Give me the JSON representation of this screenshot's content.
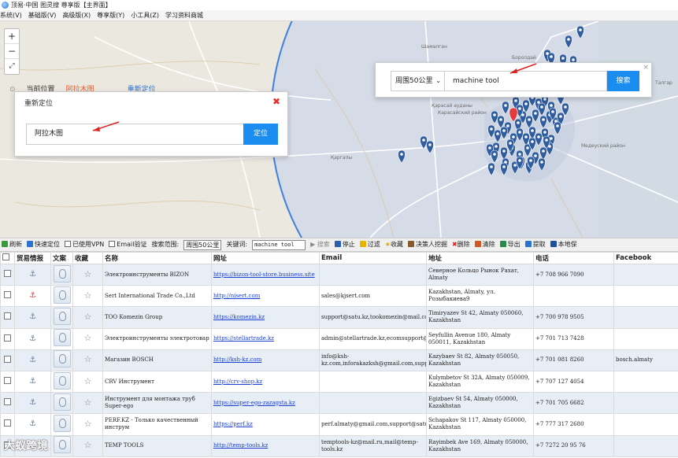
{
  "titlebar": {
    "title": "顶易·中国 图灵搜 尊享版【主界面】"
  },
  "menu": [
    "系统(V)",
    "基础版(V)",
    "高级版(X)",
    "尊享版(Y)",
    "小工具(Z)",
    "学习资料商城"
  ],
  "map": {
    "zoom_in": "+",
    "zoom_out": "−",
    "fullscreen": "⤢",
    "current_label": "当前位置",
    "current_value": "阿拉木图",
    "relocate_link": "重新定位",
    "place_labels": [
      "Шамалган",
      "Боролдай",
      "Талгар",
      "Қарасай ауданы",
      "Карасайский район",
      "Қаргалы",
      "Медеуский район"
    ],
    "relocate": {
      "title": "重新定位",
      "close": "✖",
      "input_value": "阿拉木图",
      "button": "定位"
    },
    "search": {
      "range": "周围50公里",
      "keyword": "machine tool",
      "button": "搜索",
      "close": "×"
    },
    "colors": {
      "marker": "#2f5d9e",
      "marker_active": "#e33b3b",
      "circle_fill": "#cfd8ea",
      "circle_stroke": "#3e7fe0"
    }
  },
  "toolbar": {
    "refresh": "刷新",
    "quick_locate": "快速定位",
    "vpn": "已使用VPN",
    "email_verify": "Email验证",
    "range_label": "搜索范围:",
    "range_value": "周围50公里",
    "keyword_label": "关键词:",
    "keyword_value": "machine tool",
    "search": "搜索",
    "stop": "停止",
    "filter": "过滤",
    "favorite": "收藏",
    "decision_maker": "决策人挖掘",
    "delete": "删除",
    "clear": "清除",
    "export": "导出",
    "extract": "提取",
    "save_local": "本地保"
  },
  "table": {
    "headers": [
      "",
      "贸易情报",
      "文案",
      "收藏",
      "名称",
      "网址",
      "Email",
      "地址",
      "电话",
      "Facebook"
    ],
    "rows": [
      {
        "name": "Электроинструменты BIZON",
        "url": "https://bizon-tool-store.business.site",
        "email": "",
        "address": "Северное Кольцо Рынок Рахат, Almaty",
        "phone": "+7 708 966 7090",
        "facebook": "",
        "anchor_red": false
      },
      {
        "name": "Sert International Trade Co.,Ltd",
        "url": "http://nisert.com",
        "email": "sales@kjsert.com",
        "address": "Kazakhstan, Almaty, ул. Розыбакиева9",
        "phone": "",
        "facebook": "",
        "anchor_red": true
      },
      {
        "name": "ТОО Komezin Group",
        "url": "https://komezin.kz",
        "email": "support@satu.kz,tookomezin@mail.com,komezin@bk.ru,komezingroup@",
        "address": "Timiryazev St 42, Almaty 050060, Kazakhstan",
        "phone": "+7 700 978 9505",
        "facebook": "",
        "anchor_red": false
      },
      {
        "name": "Электроинструменты электротовар",
        "url": "https://stellartrade.kz",
        "email": "admin@stellartrade.kz,ecomsupport@evopay.com.ua,support@satu.kz",
        "address": "Seyfullin Avenue 180, Almaty 050011, Kazakhstan",
        "phone": "+7 701 713 7428",
        "facebook": "",
        "anchor_red": false
      },
      {
        "name": "Магазин BOSCH",
        "url": "http://ksh-kz.com",
        "email": "info@ksh-kz.com,inforakazksh@gmail.com,support@cloudpayments.kz",
        "address": "Kazybaev St 82, Almaty 050050, Kazakhstan",
        "phone": "+7 701 081 8260",
        "facebook": "bosch.almaty",
        "anchor_red": false
      },
      {
        "name": "CRV Инструмент",
        "url": "http://crv-shop.kz",
        "email": "",
        "address": "Kulymbetov St 32A, Almaty 050009, Kazakhstan",
        "phone": "+7 707 127 4054",
        "facebook": "",
        "anchor_red": false
      },
      {
        "name": "Инструмент для монтажа труб Super-ego",
        "url": "https://super-ego-zazagsta.kz",
        "email": "",
        "address": "Egizbaev St 54, Almaty 050000, Kazakhstan",
        "phone": "+7 701 705 6682",
        "facebook": "",
        "anchor_red": false
      },
      {
        "name": "PERF.KZ - Только качественный инструм",
        "url": "https://perf.kz",
        "email": "perf.almaty@gmail.com,support@satu.kz",
        "address": "Schapakov St 117, Almaty 050000, Kazakhstan",
        "phone": "+7 777 317 2680",
        "facebook": "",
        "anchor_red": false
      },
      {
        "name": "TEMP TOOLS",
        "url": "http://temp-tools.kz",
        "email": "temptools-kz@mail.ru,mail@temp-tools.kz",
        "address": "Rayimbek Ave 169, Almaty 050000, Kazakhstan",
        "phone": "+7 7272 20 95 76",
        "facebook": "",
        "anchor_red": false
      }
    ]
  },
  "watermark": "大蚁跨境"
}
